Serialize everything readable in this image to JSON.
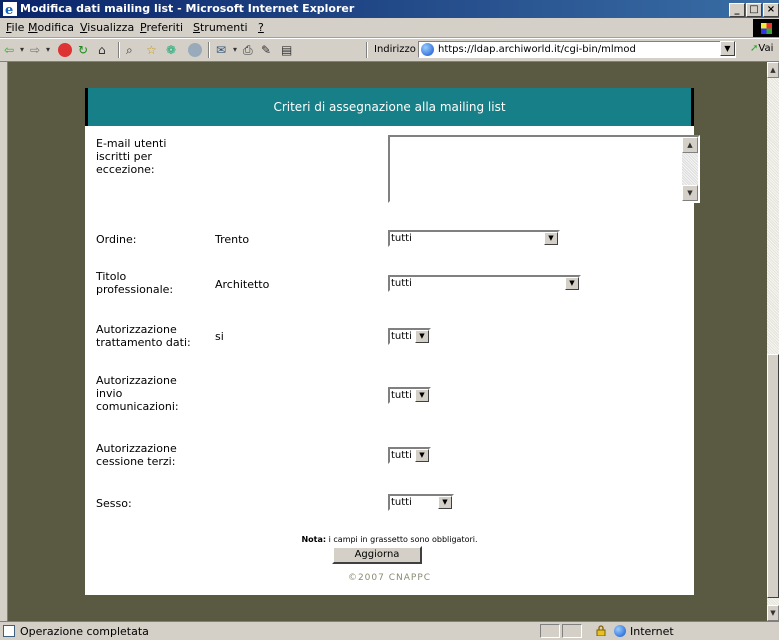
{
  "window": {
    "title": "Modifica dati mailing list - Microsoft Internet Explorer",
    "buttons": [
      "_",
      "□",
      "×"
    ]
  },
  "menu": [
    {
      "label": "File",
      "key": "F",
      "rest": "ile"
    },
    {
      "label": "Modifica",
      "key": "M",
      "rest": "odifica"
    },
    {
      "label": "Visualizza",
      "key": "V",
      "rest": "isualizza"
    },
    {
      "label": "Preferiti",
      "key": "P",
      "rest": "referiti"
    },
    {
      "label": "Strumenti",
      "key": "S",
      "rest": "trumenti"
    },
    {
      "label": "?",
      "key": "?",
      "rest": ""
    }
  ],
  "toolbar": {
    "address_label": "Indirizzo",
    "url": "https://ldap.archiworld.it/cgi-bin/mlmod",
    "go_label": "Vai"
  },
  "page": {
    "heading": "Criteri di assegnazione alla mailing list",
    "fields": {
      "email_label": "E-mail utenti iscritti per eccezione:",
      "email_value": "",
      "ordine_label": "Ordine:",
      "ordine_value": "Trento",
      "ordine_select": "tutti",
      "titolo_label": "Titolo professionale:",
      "titolo_value": "Architetto",
      "titolo_select": "tutti",
      "auth_tratt_label": "Autorizzazione trattamento dati:",
      "auth_tratt_value": "si",
      "auth_tratt_select": "tutti",
      "auth_invio_label": "Autorizzazione invio comunicazioni:",
      "auth_invio_select": "tutti",
      "auth_cessione_label": "Autorizzazione cessione terzi:",
      "auth_cessione_select": "tutti",
      "sesso_label": "Sesso:",
      "sesso_select": "tutti"
    },
    "note_bold": "Nota:",
    "note_text": " i campi in grassetto sono obbligatori.",
    "submit_label": "Aggiorna",
    "copyright": "©2007 CNAPPC"
  },
  "status": {
    "text": "Operazione completata",
    "zone": "Internet"
  }
}
